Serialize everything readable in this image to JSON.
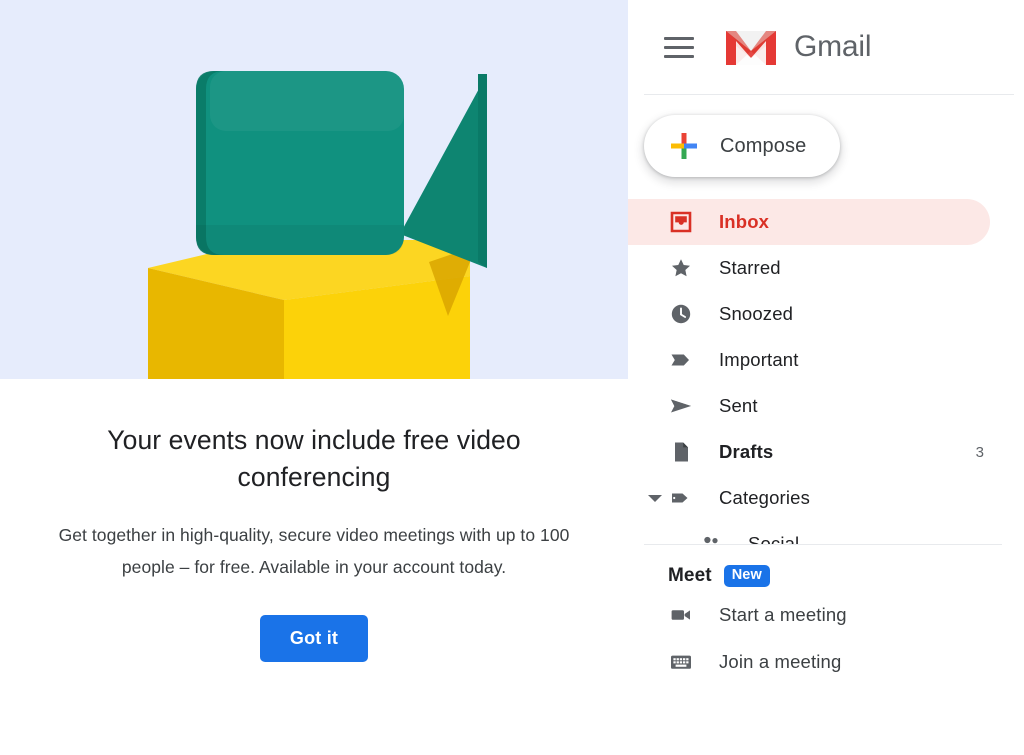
{
  "promo": {
    "hero_bg": "#e6ecfc",
    "hero_icon": "video-camera-on-cube-illustration",
    "title": "Your events now include free video conferencing",
    "description": "Get together in high-quality, secure video meetings with up to 100 people – for free. Available in your account today.",
    "cta_label": "Got it",
    "cta_color": "#1a73e8",
    "colors": {
      "camera_body": "#10917f",
      "cube": "#fcd209",
      "background": "#e6ecfc"
    }
  },
  "sidebar": {
    "header": {
      "menu_icon": "hamburger-menu-icon",
      "logo_icon": "gmail-logo-icon",
      "brand": "Gmail"
    },
    "compose": {
      "icon": "plus-icon",
      "label": "Compose"
    },
    "nav_items": [
      {
        "label": "Inbox",
        "icon": "inbox-icon",
        "count": "",
        "active": true,
        "bold": true,
        "sub": false
      },
      {
        "label": "Starred",
        "icon": "star-icon",
        "count": "",
        "active": false,
        "bold": false,
        "sub": false
      },
      {
        "label": "Snoozed",
        "icon": "clock-icon",
        "count": "",
        "active": false,
        "bold": false,
        "sub": false
      },
      {
        "label": "Important",
        "icon": "label-important-icon",
        "count": "",
        "active": false,
        "bold": false,
        "sub": false
      },
      {
        "label": "Sent",
        "icon": "send-icon",
        "count": "",
        "active": false,
        "bold": false,
        "sub": false
      },
      {
        "label": "Drafts",
        "icon": "draft-icon",
        "count": "3",
        "active": false,
        "bold": true,
        "sub": false
      },
      {
        "label": "Categories",
        "icon": "label-icon",
        "count": "",
        "active": false,
        "bold": false,
        "sub": false,
        "caret": true
      },
      {
        "label": "Social",
        "icon": "people-icon",
        "count": "",
        "active": false,
        "bold": false,
        "sub": true
      }
    ],
    "meet": {
      "title": "Meet",
      "badge": "New",
      "badge_color": "#1a73e8",
      "items": [
        {
          "label": "Start a meeting",
          "icon": "videocam-icon"
        },
        {
          "label": "Join a meeting",
          "icon": "keyboard-icon"
        }
      ]
    },
    "active_color": "#d93025",
    "active_bg": "#fce8e6"
  }
}
